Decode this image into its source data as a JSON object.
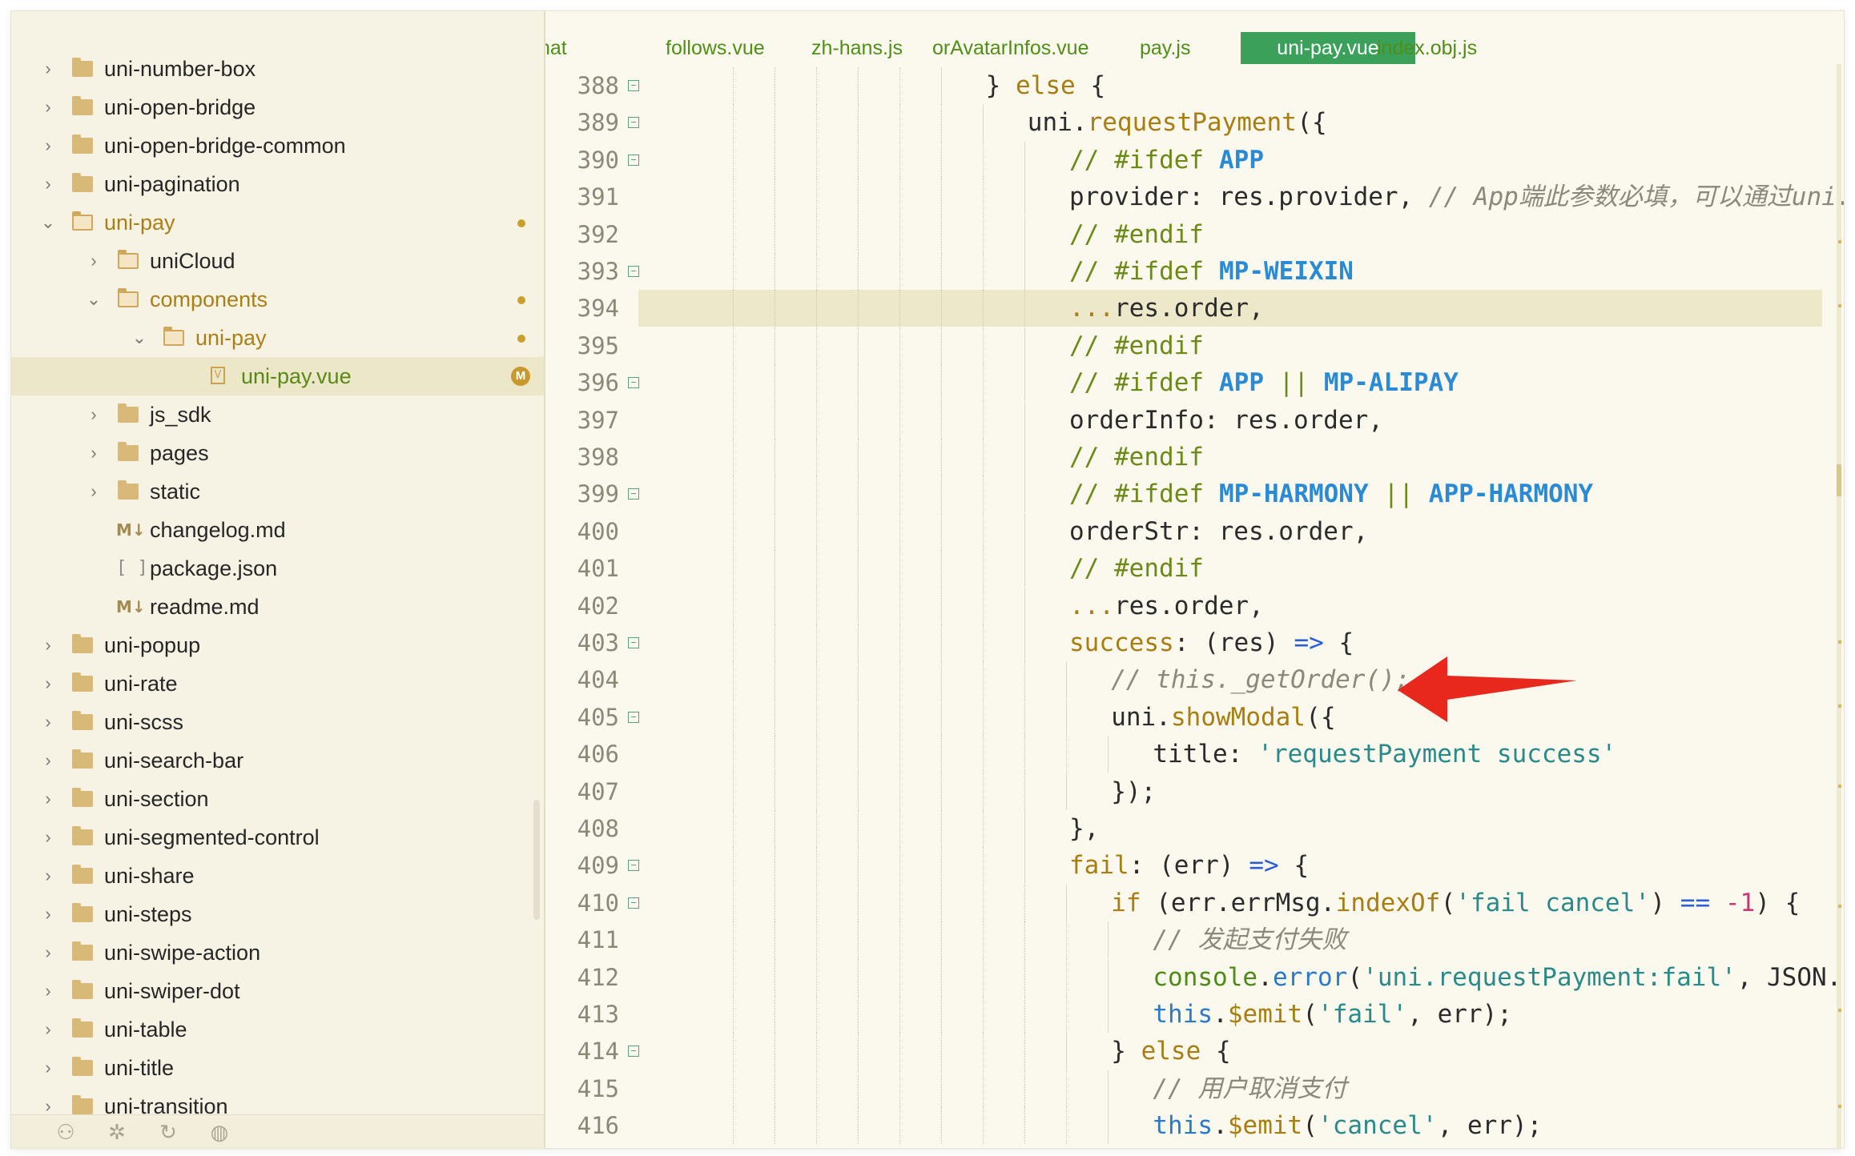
{
  "sidebar": {
    "items": [
      {
        "label": "uni-number-box",
        "icon": "folder-icon",
        "depth": 0,
        "chevron": "right",
        "style": "normal",
        "badge": ""
      },
      {
        "label": "uni-open-bridge",
        "icon": "folder-icon",
        "depth": 0,
        "chevron": "right",
        "style": "normal",
        "badge": ""
      },
      {
        "label": "uni-open-bridge-common",
        "icon": "folder-icon",
        "depth": 0,
        "chevron": "right",
        "style": "normal",
        "badge": ""
      },
      {
        "label": "uni-pagination",
        "icon": "folder-icon",
        "depth": 0,
        "chevron": "right",
        "style": "normal",
        "badge": ""
      },
      {
        "label": "uni-pay",
        "icon": "folder-open-icon",
        "depth": 0,
        "chevron": "down",
        "style": "gold",
        "badge": "dot"
      },
      {
        "label": "uniCloud",
        "icon": "cloud-folder-icon",
        "depth": 1,
        "chevron": "right",
        "style": "normal",
        "badge": ""
      },
      {
        "label": "components",
        "icon": "folder-open-icon",
        "depth": 1,
        "chevron": "down",
        "style": "gold",
        "badge": "dot"
      },
      {
        "label": "uni-pay",
        "icon": "folder-open-icon",
        "depth": 2,
        "chevron": "down",
        "style": "gold",
        "badge": "dot"
      },
      {
        "label": "uni-pay.vue",
        "icon": "vue-file-icon",
        "depth": 3,
        "chevron": "",
        "style": "green",
        "badge": "M",
        "active": true
      },
      {
        "label": "js_sdk",
        "icon": "folder-icon",
        "depth": 1,
        "chevron": "right",
        "style": "normal",
        "badge": ""
      },
      {
        "label": "pages",
        "icon": "folder-icon",
        "depth": 1,
        "chevron": "right",
        "style": "normal",
        "badge": ""
      },
      {
        "label": "static",
        "icon": "folder-icon",
        "depth": 1,
        "chevron": "right",
        "style": "normal",
        "badge": ""
      },
      {
        "label": "changelog.md",
        "icon": "markdown-file-icon",
        "depth": 1,
        "chevron": "",
        "style": "normal",
        "badge": ""
      },
      {
        "label": "package.json",
        "icon": "json-file-icon",
        "depth": 1,
        "chevron": "",
        "style": "normal",
        "badge": ""
      },
      {
        "label": "readme.md",
        "icon": "markdown-file-icon",
        "depth": 1,
        "chevron": "",
        "style": "normal",
        "badge": ""
      },
      {
        "label": "uni-popup",
        "icon": "folder-icon",
        "depth": 0,
        "chevron": "right",
        "style": "normal",
        "badge": ""
      },
      {
        "label": "uni-rate",
        "icon": "folder-icon",
        "depth": 0,
        "chevron": "right",
        "style": "normal",
        "badge": ""
      },
      {
        "label": "uni-scss",
        "icon": "folder-icon",
        "depth": 0,
        "chevron": "right",
        "style": "normal",
        "badge": ""
      },
      {
        "label": "uni-search-bar",
        "icon": "folder-icon",
        "depth": 0,
        "chevron": "right",
        "style": "normal",
        "badge": ""
      },
      {
        "label": "uni-section",
        "icon": "folder-icon",
        "depth": 0,
        "chevron": "right",
        "style": "normal",
        "badge": ""
      },
      {
        "label": "uni-segmented-control",
        "icon": "folder-icon",
        "depth": 0,
        "chevron": "right",
        "style": "normal",
        "badge": ""
      },
      {
        "label": "uni-share",
        "icon": "folder-icon",
        "depth": 0,
        "chevron": "right",
        "style": "normal",
        "badge": ""
      },
      {
        "label": "uni-steps",
        "icon": "folder-icon",
        "depth": 0,
        "chevron": "right",
        "style": "normal",
        "badge": ""
      },
      {
        "label": "uni-swipe-action",
        "icon": "folder-icon",
        "depth": 0,
        "chevron": "right",
        "style": "normal",
        "badge": ""
      },
      {
        "label": "uni-swiper-dot",
        "icon": "folder-icon",
        "depth": 0,
        "chevron": "right",
        "style": "normal",
        "badge": ""
      },
      {
        "label": "uni-table",
        "icon": "folder-icon",
        "depth": 0,
        "chevron": "right",
        "style": "normal",
        "badge": ""
      },
      {
        "label": "uni-title",
        "icon": "folder-icon",
        "depth": 0,
        "chevron": "right",
        "style": "normal",
        "badge": ""
      },
      {
        "label": "uni-transition",
        "icon": "folder-icon",
        "depth": 0,
        "chevron": "right",
        "style": "normal",
        "badge": ""
      }
    ],
    "bottom_icons": [
      "binoculars-icon",
      "bug-icon",
      "refresh-icon",
      "globe-icon"
    ]
  },
  "tabs": [
    {
      "label": "hat",
      "active": false
    },
    {
      "label": "follows.vue",
      "active": false
    },
    {
      "label": "zh-hans.js",
      "active": false
    },
    {
      "label": "orAvatarInfos.vue",
      "active": false
    },
    {
      "label": "pay.js",
      "active": false
    },
    {
      "label": "uni-pay.vue",
      "active": true
    },
    {
      "label": "index.obj.js",
      "active": false
    }
  ],
  "editor": {
    "lines": [
      {
        "n": "388",
        "fold": true,
        "indent": 8,
        "tokens": [
          [
            "} ",
            "p"
          ],
          [
            "else",
            "kw"
          ],
          [
            " {",
            "p"
          ]
        ]
      },
      {
        "n": "389",
        "fold": true,
        "indent": 9,
        "tokens": [
          [
            "uni.",
            "p"
          ],
          [
            "requestPayment",
            "fn"
          ],
          [
            "({",
            "p"
          ]
        ]
      },
      {
        "n": "390",
        "fold": true,
        "indent": 10,
        "tokens": [
          [
            "// ",
            "pre"
          ],
          [
            "#ifdef ",
            "pre"
          ],
          [
            "APP",
            "mac"
          ]
        ]
      },
      {
        "n": "391",
        "fold": false,
        "indent": 10,
        "tokens": [
          [
            "provider: res.provider, ",
            "p"
          ],
          [
            "// App端此参数必填，可以通过uni.getProvider",
            "cmt"
          ]
        ]
      },
      {
        "n": "392",
        "fold": false,
        "indent": 10,
        "tokens": [
          [
            "// #endif",
            "pre"
          ]
        ]
      },
      {
        "n": "393",
        "fold": true,
        "indent": 10,
        "tokens": [
          [
            "// ",
            "pre"
          ],
          [
            "#ifdef ",
            "pre"
          ],
          [
            "MP-WEIXIN",
            "mac"
          ]
        ]
      },
      {
        "n": "394",
        "fold": false,
        "indent": 10,
        "highlight": true,
        "tokens": [
          [
            "...",
            "kw"
          ],
          [
            "res.order,",
            "p"
          ]
        ]
      },
      {
        "n": "395",
        "fold": false,
        "indent": 10,
        "tokens": [
          [
            "// #endif",
            "pre"
          ]
        ]
      },
      {
        "n": "396",
        "fold": true,
        "indent": 10,
        "tokens": [
          [
            "// ",
            "pre"
          ],
          [
            "#ifdef ",
            "pre"
          ],
          [
            "APP",
            "mac"
          ],
          [
            " || ",
            "pre"
          ],
          [
            "MP-ALIPAY",
            "mac"
          ]
        ]
      },
      {
        "n": "397",
        "fold": false,
        "indent": 10,
        "tokens": [
          [
            "orderInfo: res.order,",
            "p"
          ]
        ]
      },
      {
        "n": "398",
        "fold": false,
        "indent": 10,
        "tokens": [
          [
            "// #endif",
            "pre"
          ]
        ]
      },
      {
        "n": "399",
        "fold": true,
        "indent": 10,
        "tokens": [
          [
            "// ",
            "pre"
          ],
          [
            "#ifdef ",
            "pre"
          ],
          [
            "MP-HARMONY",
            "mac"
          ],
          [
            " || ",
            "pre"
          ],
          [
            "APP-HARMONY",
            "mac"
          ]
        ]
      },
      {
        "n": "400",
        "fold": false,
        "indent": 10,
        "tokens": [
          [
            "orderStr: res.order,",
            "p"
          ]
        ]
      },
      {
        "n": "401",
        "fold": false,
        "indent": 10,
        "tokens": [
          [
            "// #endif",
            "pre"
          ]
        ]
      },
      {
        "n": "402",
        "fold": false,
        "indent": 10,
        "tokens": [
          [
            "...",
            "kw"
          ],
          [
            "res.order,",
            "p"
          ]
        ]
      },
      {
        "n": "403",
        "fold": true,
        "indent": 10,
        "tokens": [
          [
            "success",
            "kw"
          ],
          [
            ": (res) ",
            "p"
          ],
          [
            "=>",
            "op"
          ],
          [
            " {",
            "p"
          ]
        ]
      },
      {
        "n": "404",
        "fold": false,
        "indent": 11,
        "tokens": [
          [
            "// this._getOrder();",
            "cmt"
          ]
        ]
      },
      {
        "n": "405",
        "fold": true,
        "indent": 11,
        "tokens": [
          [
            "uni.",
            "p"
          ],
          [
            "showModal",
            "fn"
          ],
          [
            "({",
            "p"
          ]
        ]
      },
      {
        "n": "406",
        "fold": false,
        "indent": 12,
        "tokens": [
          [
            "title: ",
            "p"
          ],
          [
            "'requestPayment success'",
            "str"
          ]
        ]
      },
      {
        "n": "407",
        "fold": false,
        "indent": 11,
        "tokens": [
          [
            "});",
            "p"
          ]
        ]
      },
      {
        "n": "408",
        "fold": false,
        "indent": 10,
        "tokens": [
          [
            "},",
            "p"
          ]
        ]
      },
      {
        "n": "409",
        "fold": true,
        "indent": 10,
        "tokens": [
          [
            "fail",
            "kw"
          ],
          [
            ": (err) ",
            "p"
          ],
          [
            "=>",
            "op"
          ],
          [
            " {",
            "p"
          ]
        ]
      },
      {
        "n": "410",
        "fold": true,
        "indent": 11,
        "tokens": [
          [
            "if",
            "kw"
          ],
          [
            " (err.errMsg.",
            "p"
          ],
          [
            "indexOf",
            "fn"
          ],
          [
            "(",
            "p"
          ],
          [
            "'fail cancel'",
            "str"
          ],
          [
            ") ",
            "p"
          ],
          [
            "==",
            "op"
          ],
          [
            " ",
            "p"
          ],
          [
            "-1",
            "num"
          ],
          [
            ") {",
            "p"
          ]
        ]
      },
      {
        "n": "411",
        "fold": false,
        "indent": 12,
        "tokens": [
          [
            "// 发起支付失败",
            "cmt"
          ]
        ]
      },
      {
        "n": "412",
        "fold": false,
        "indent": 12,
        "tokens": [
          [
            "console",
            "green"
          ],
          [
            ".",
            "p"
          ],
          [
            "error",
            "blue"
          ],
          [
            "(",
            "p"
          ],
          [
            "'uni.requestPayment:fail'",
            "str"
          ],
          [
            ", JSON.stringify(err));",
            "p"
          ]
        ]
      },
      {
        "n": "413",
        "fold": false,
        "indent": 12,
        "tokens": [
          [
            "this",
            "blue"
          ],
          [
            ".",
            "p"
          ],
          [
            "$emit",
            "fn"
          ],
          [
            "(",
            "p"
          ],
          [
            "'fail'",
            "str"
          ],
          [
            ", err);",
            "p"
          ]
        ]
      },
      {
        "n": "414",
        "fold": true,
        "indent": 11,
        "tokens": [
          [
            "} ",
            "p"
          ],
          [
            "else",
            "kw"
          ],
          [
            " {",
            "p"
          ]
        ]
      },
      {
        "n": "415",
        "fold": false,
        "indent": 12,
        "tokens": [
          [
            "// 用户取消支付",
            "cmt"
          ]
        ]
      },
      {
        "n": "416",
        "fold": false,
        "indent": 12,
        "tokens": [
          [
            "this",
            "blue"
          ],
          [
            ".",
            "p"
          ],
          [
            "$emit",
            "fn"
          ],
          [
            "(",
            "p"
          ],
          [
            "'cancel'",
            "str"
          ],
          [
            ", err);",
            "p"
          ]
        ]
      }
    ]
  },
  "colors": {
    "accent_tab": "#3aa05a",
    "annotation_arrow": "#e8281c",
    "keyword": "#a87d12",
    "string": "#2a8a8a",
    "macro": "#2a8bd4"
  }
}
